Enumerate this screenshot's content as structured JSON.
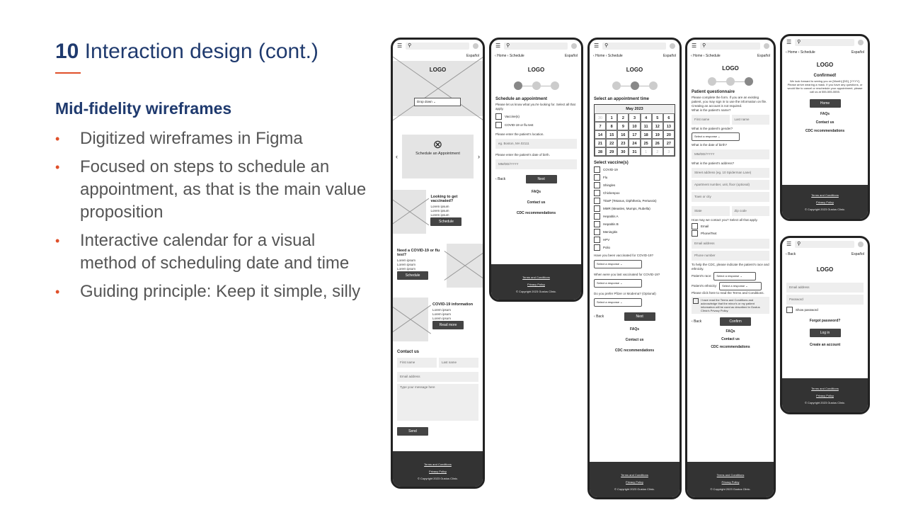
{
  "slide": {
    "number": "10",
    "title": "Interaction design (cont.)",
    "subheading": "Mid-fidelity wireframes",
    "bullets": [
      "Digitized wireframes in Figma",
      "Focused on steps to schedule an appointment, as that is the main value proposition",
      "Interactive calendar for a visual method of scheduling date and time",
      "Guiding principle: Keep it simple, silly"
    ]
  },
  "common": {
    "lang": "Español",
    "home": "Home",
    "schedule": "Schedule",
    "back": "Back",
    "logo": "LOGO",
    "terms": "Terms and Conditions",
    "privacy": "Privacy Policy",
    "copyright": "© Copyright 2023 Gustus Clinic.",
    "faqs": "FAQs",
    "contact": "Contact us",
    "cdc": "CDC recommendations",
    "next": "Next"
  },
  "p1": {
    "dropdown": "Drop down",
    "card": "Schedule an Appointment",
    "looking": "Looking to get vaccinated?",
    "lorem": "Lorem ipsum",
    "schedule_btn": "Schedule",
    "need": "Need a COVID-19 or flu test?",
    "covid": "COVID-19 information",
    "read_more": "Read more",
    "contact_us": "Contact us",
    "first": "First name",
    "last": "Last name",
    "email": "Email address",
    "message": "Type your message here",
    "send": "Send"
  },
  "p2": {
    "heading": "Schedule an appointment",
    "intro": "Please let us know what you're looking for. Select all that apply.",
    "opt1": "Vaccine(s)",
    "opt2": "COVID-19 or flu test",
    "loc_label": "Please enter the patient's location.",
    "loc_ph": "eg. Boston, MA 02111",
    "dob_label": "Please enter the patient's date of birth.",
    "dob_ph": "MM/DD/YYYY"
  },
  "p3": {
    "heading": "Select an appointment time",
    "month": "May 2023",
    "days": [
      "30",
      "1",
      "2",
      "3",
      "4",
      "5",
      "6",
      "7",
      "8",
      "9",
      "10",
      "11",
      "12",
      "13",
      "14",
      "15",
      "16",
      "17",
      "18",
      "19",
      "20",
      "21",
      "22",
      "23",
      "24",
      "25",
      "26",
      "27",
      "28",
      "29",
      "30",
      "31",
      "1",
      "2",
      "3"
    ],
    "vacc_heading": "Select vaccine(s)",
    "vaccines": [
      "COVID-19",
      "Flu",
      "Shingles",
      "Chickenpox",
      "TDaP (Tetanus, Diphtheria, Pertussis)",
      "MMR (Measles, Mumps, Rubella)",
      "Hepatitis A",
      "Hepatitis B",
      "Meningitis",
      "HPV",
      "Polio"
    ],
    "q1": "Have you been vaccinated for COVID-19?",
    "q2": "When were you last vaccinated for COVID-19?",
    "q3": "Do you prefer Pfizer or Moderna? (Optional)",
    "select": "Select a response"
  },
  "p4": {
    "heading": "Patient questionnaire",
    "intro": "Please complete the form. If you are an existing patient, you may sign in to use the information on file. Creating an account is not required.",
    "name_q": "What is the patient's name?",
    "gender_q": "What is the patient's gender?",
    "dob_q": "What is the date of birth?",
    "addr_q": "What is the patient's address?",
    "street": "Street address (eg. 10 Spiderman Lane)",
    "apt": "Apartment number, unit, floor (optional)",
    "town": "Town or city",
    "state": "State",
    "zip": "Zip code",
    "contact_q": "How may we contact you? Select all that apply.",
    "email": "Email",
    "phone": "Phone/Text",
    "email_addr": "Email address",
    "phone_num": "Phone number",
    "cdc_q": "To help the CDC, please indicate the patient's race and ethnicity.",
    "race": "Patient's race:",
    "eth": "Patient's ethnicity:",
    "terms_q": "Please click here to read the Terms and Conditions.",
    "agree": "I have read the Terms and Conditions and acknowledge that the minor's or my patient information will be used as described in Gustus Clinic's Privacy Policy.",
    "confirm": "Confirm"
  },
  "p5": {
    "heading": "Confirmed!",
    "body": "We look forward to seeing you on [Month] [DD], [YYYY]. Please arrive wearing a mask. If you have any questions, or would like to cancel or reschedule your appointment, please call us at 555-555-5555.",
    "home_btn": "Home"
  },
  "p6": {
    "email": "Email address",
    "password": "Password",
    "show": "Show password",
    "forgot": "Forgot password?",
    "login": "Log in",
    "create": "Create an account"
  }
}
